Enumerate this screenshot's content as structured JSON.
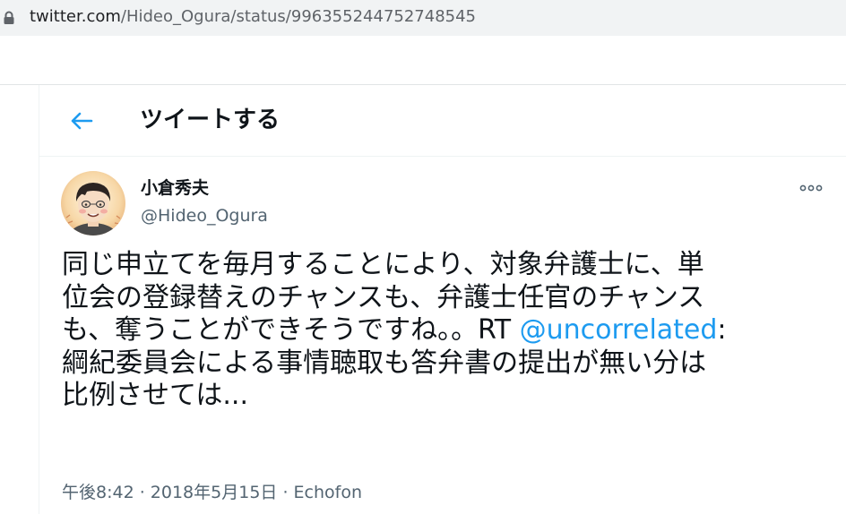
{
  "address_bar": {
    "url_host": "twitter.com",
    "url_path": "/Hideo_Ogura/status/996355244752748545"
  },
  "header": {
    "title": "ツイートする"
  },
  "tweet": {
    "display_name": "小倉秀夫",
    "handle": "@Hideo_Ogura",
    "text_lines": [
      "同じ申立てを毎月することにより、対象弁護士に、単",
      "位会の登録替えのチャンスも、弁護士任官のチャンス",
      "も、奪うことができそうですね。。RT ",
      "綱紀委員会による事情聴取も答弁書の提出が無い分は",
      "比例させては..."
    ],
    "mention": "@uncorrelated",
    "mention_suffix": ":",
    "time": "午後8:42",
    "separator": " · ",
    "date": "2018年5月15日",
    "source": "Echofon"
  },
  "colors": {
    "accent": "#1d9bf0",
    "text": "#0f1419",
    "secondary": "#536471",
    "address_bar_bg": "#f1f3f4"
  },
  "icons": {
    "lock": "lock-icon",
    "back": "back-arrow-icon",
    "more": "more-dots-icon"
  }
}
